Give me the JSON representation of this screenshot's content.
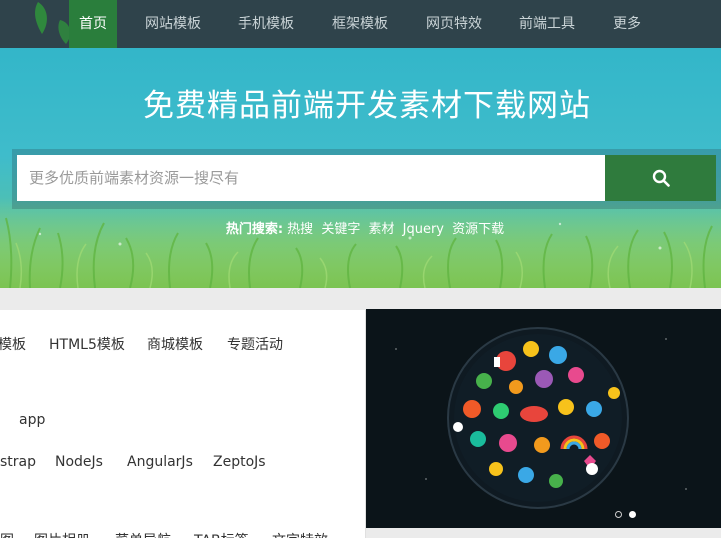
{
  "nav": {
    "items": [
      {
        "label": "首页",
        "active": true
      },
      {
        "label": "网站模板"
      },
      {
        "label": "手机模板"
      },
      {
        "label": "框架模板"
      },
      {
        "label": "网页特效"
      },
      {
        "label": "前端工具"
      },
      {
        "label": "更多"
      }
    ]
  },
  "hero": {
    "title": "免费精品前端开发素材下载网站",
    "search_placeholder": "更多优质前端素材资源一搜尽有",
    "search_icon": "search-icon",
    "hot_label": "热门搜索:",
    "hot_keywords": [
      "热搜",
      "关键字",
      "素材",
      "Jquery",
      "资源下载"
    ]
  },
  "categories": {
    "row1": [
      "模板",
      "HTML5模板",
      "商城模板",
      "专题活动"
    ],
    "row2": [
      "app"
    ],
    "row3": [
      "strap",
      "NodeJs",
      "AngularJs",
      "ZeptoJs"
    ],
    "row4": [
      "图",
      "图片相册",
      "菜单导航",
      "TAB标签",
      "文字特效"
    ]
  },
  "banner": {
    "image": "colorful-icons-circle-banner",
    "slides_total": 2,
    "active_slide": 2
  },
  "colors": {
    "nav_bg": "#2f434b",
    "nav_active": "#2a7e3c",
    "search_button": "#2f7b3d",
    "hero_sky": "#3fbccb"
  }
}
